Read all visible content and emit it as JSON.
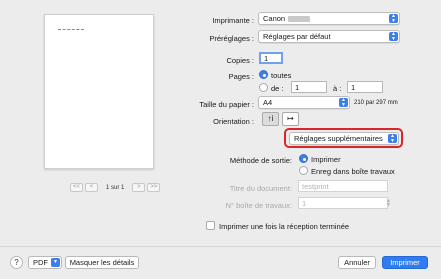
{
  "preview": {
    "page_label": "1 sur 1",
    "nav_first": "<<",
    "nav_prev": "<",
    "nav_next": ">",
    "nav_last": ">>"
  },
  "printer": {
    "label": "Imprimante :",
    "value": "Canon"
  },
  "presets": {
    "label": "Préréglages :",
    "value": "Réglages par défaut"
  },
  "copies": {
    "label": "Copies :",
    "value": "1"
  },
  "pages": {
    "label": "Pages :",
    "all_label": "toutes",
    "from_label": "de :",
    "from_value": "1",
    "to_label": "à :",
    "to_value": "1",
    "selected": "all"
  },
  "paper": {
    "label": "Taille du papier :",
    "value": "A4",
    "dimensions": "210 par 297 mm"
  },
  "orientation": {
    "label": "Orientation :",
    "portrait_glyph": "↑i",
    "landscape_glyph": "↦"
  },
  "panel_menu": {
    "value": "Réglages supplémentaires"
  },
  "output": {
    "label": "Méthode de sortie:",
    "option_print": "Imprimer",
    "option_store": "Enreg dans boîte travaux",
    "selected": "print"
  },
  "doc_title": {
    "label": "Titre du document:",
    "value": "testprint"
  },
  "job_box": {
    "label": "N° boîte de travaux:",
    "value": "1"
  },
  "print_after_receive": {
    "label": "Imprimer une fois la réception terminée",
    "checked": false
  },
  "footer": {
    "help": "?",
    "pdf": "PDF",
    "hide_details": "Masquer les détails",
    "cancel": "Annuler",
    "print": "Imprimer"
  },
  "colors": {
    "accent": "#3d7ee8",
    "highlight": "#d8262b"
  }
}
